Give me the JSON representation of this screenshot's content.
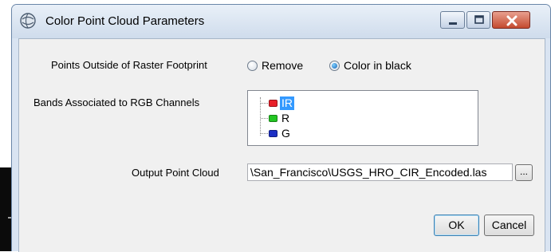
{
  "window": {
    "title": "Color Point Cloud Parameters"
  },
  "icons": {
    "app": "arcgis-globe-icon",
    "minimize": "minimize-icon",
    "maximize": "maximize-icon",
    "close": "close-icon",
    "background": "arrow-icon"
  },
  "outside_footprint": {
    "label": "Points Outside of Raster Footprint",
    "options": [
      {
        "label": "Remove",
        "selected": false
      },
      {
        "label": "Color in black",
        "selected": true
      }
    ]
  },
  "bands": {
    "label": "Bands Associated to RGB Channels",
    "items": [
      {
        "label": "IR",
        "color": "#e8202a",
        "selected": true
      },
      {
        "label": "R",
        "color": "#22c622",
        "selected": false
      },
      {
        "label": "G",
        "color": "#1c2fc4",
        "selected": false
      }
    ]
  },
  "output": {
    "label": "Output Point Cloud",
    "value": "\\San_Francisco\\USGS_HRO_CIR_Encoded.las",
    "browse_label": "..."
  },
  "buttons": {
    "ok": "OK",
    "cancel": "Cancel"
  }
}
